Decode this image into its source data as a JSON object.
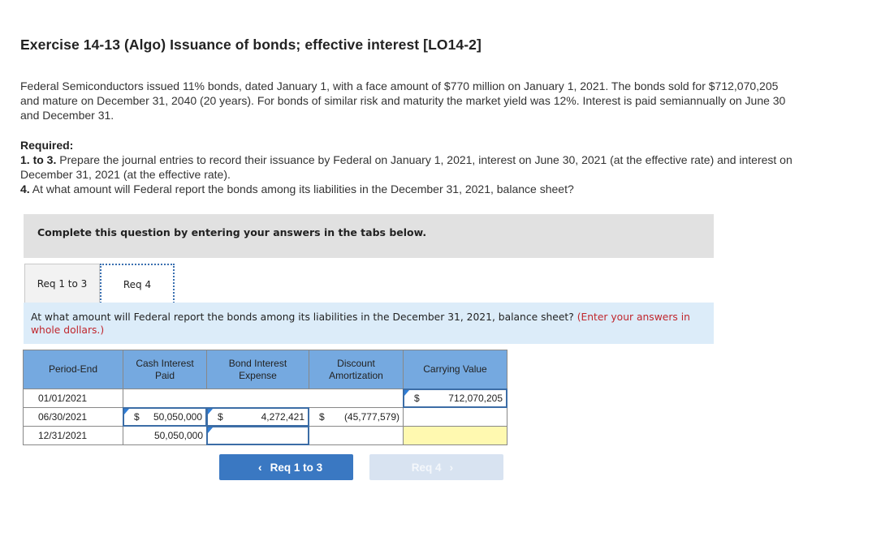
{
  "title": "Exercise 14-13 (Algo) Issuance of bonds; effective interest [LO14-2]",
  "intro": "Federal Semiconductors issued 11% bonds, dated January 1, with a face amount of $770 million on January 1, 2021. The bonds sold for $712,070,205 and mature on December 31, 2040 (20 years). For bonds of similar risk and maturity the market yield was 12%. Interest is paid semiannually on June 30 and December 31.",
  "required": {
    "heading": "Required:",
    "items": [
      {
        "label": "1. to 3.",
        "text": " Prepare the journal entries to record their issuance by Federal on January 1, 2021, interest on June 30, 2021 (at the effective rate) and interest on December 31, 2021 (at the effective rate)."
      },
      {
        "label": "4.",
        "text": " At what amount will Federal report the bonds among its liabilities in the December 31, 2021, balance sheet?"
      }
    ]
  },
  "banner": "Complete this question by entering your answers in the tabs below.",
  "tabs": [
    {
      "label": "Req 1 to 3",
      "active": false
    },
    {
      "label": "Req 4",
      "active": true
    }
  ],
  "question": {
    "text": "At what amount will Federal report the bonds among its liabilities in the December 31, 2021, balance sheet? ",
    "note": "(Enter your answers in whole dollars.)"
  },
  "table": {
    "headers": [
      "Period-End",
      "Cash Interest Paid",
      "Bond Interest Expense",
      "Discount Amortization",
      "Carrying Value"
    ],
    "rows": [
      {
        "period": "01/01/2021",
        "cash": "",
        "expense": "",
        "amortization": "",
        "carrying": "712,070,205"
      },
      {
        "period": "06/30/2021",
        "cash": "50,050,000",
        "expense": "4,272,421",
        "amortization": "(45,777,579)",
        "carrying": ""
      },
      {
        "period": "12/31/2021",
        "cash": "50,050,000",
        "expense": "",
        "amortization": "",
        "carrying": ""
      }
    ],
    "currency": "$"
  },
  "nav": {
    "prev_label": "Req 1 to 3",
    "next_label": "Req 4",
    "prev_icon": "‹",
    "next_icon": "›"
  }
}
